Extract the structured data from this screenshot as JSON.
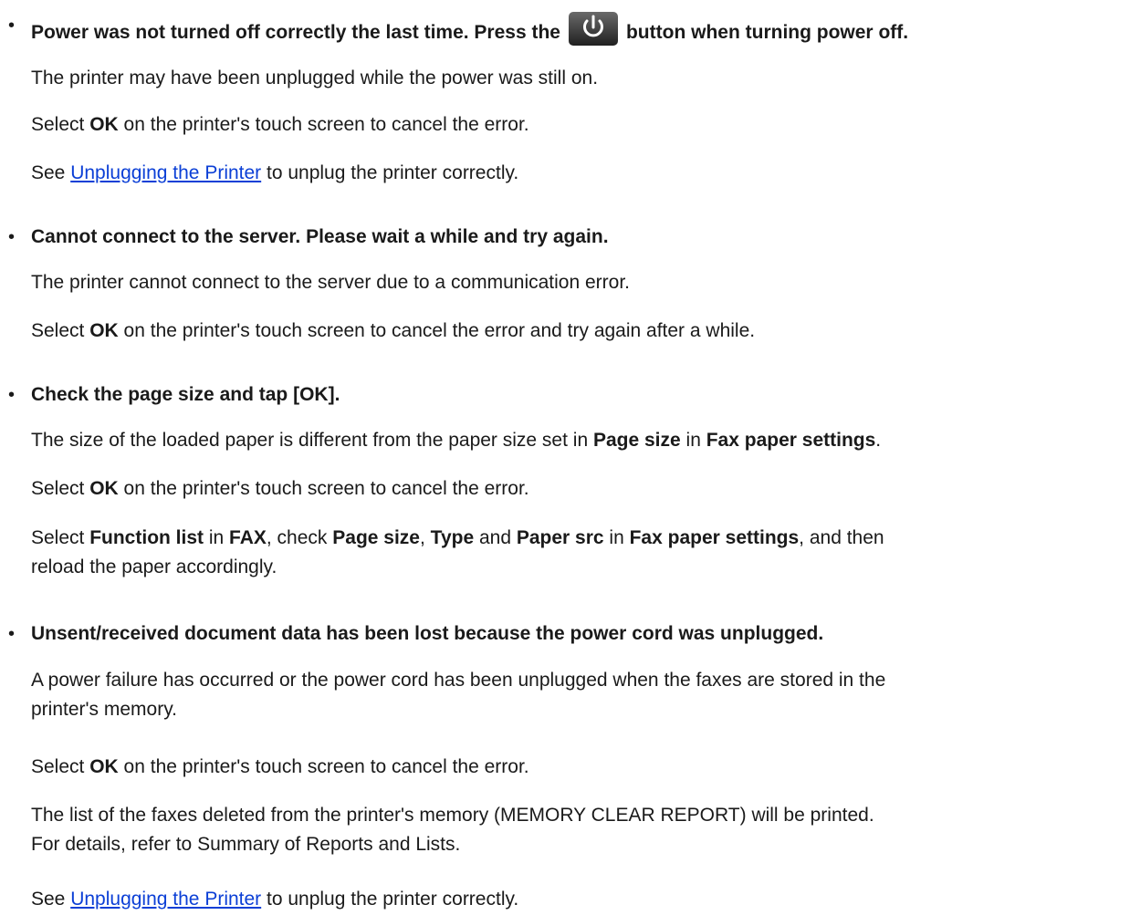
{
  "items": [
    {
      "heading_pre": "Power was not turned off correctly the last time. Press the",
      "heading_post": "button when turning power off.",
      "heading_icon": "power-button-icon",
      "p1": "The printer may have been unplugged while the power was still on.",
      "p2": {
        "pre": "Select ",
        "b1": "OK",
        "post": " on the printer's touch screen to cancel the error."
      },
      "p3": {
        "pre": "See ",
        "link": "Unplugging the Printer",
        "post": " to unplug the printer correctly."
      }
    },
    {
      "heading": "Cannot connect to the server. Please wait a while and try again.",
      "p1": "The printer cannot connect to the server due to a communication error.",
      "p2": {
        "pre": "Select ",
        "b1": "OK",
        "post": " on the printer's touch screen to cancel the error and try again after a while."
      }
    },
    {
      "heading": "Check the page size and tap [OK].",
      "p1": {
        "pre": "The size of the loaded paper is different from the paper size set in ",
        "b1": "Page size",
        "mid": " in ",
        "b2": "Fax paper settings",
        "post": "."
      },
      "p2": {
        "pre": "Select ",
        "b1": "OK",
        "post": " on the printer's touch screen to cancel the error."
      },
      "p3": {
        "t1": "Select ",
        "b1": "Function list",
        "t2": " in ",
        "b2": "FAX",
        "t3": ", check ",
        "b3": "Page size",
        "t4": ", ",
        "b4": "Type",
        "t5": " and ",
        "b5": "Paper src",
        "t6": " in ",
        "b6": "Fax paper settings",
        "t7": ", and then",
        "line2": "reload the paper accordingly."
      }
    },
    {
      "heading": "Unsent/received document data has been lost because the power cord was unplugged.",
      "p1": {
        "line1": "A power failure has occurred or the power cord has been unplugged when the faxes are stored in the",
        "line2": "printer's memory."
      },
      "p2": {
        "pre": "Select ",
        "b1": "OK",
        "post": " on the printer's touch screen to cancel the error."
      },
      "p3": {
        "line1": "The list of the faxes deleted from the printer's memory (MEMORY CLEAR REPORT) will be printed.",
        "line2": "For details, refer to Summary of Reports and Lists."
      },
      "p4": {
        "pre": "See ",
        "link": "Unplugging the Printer",
        "post": " to unplug the printer correctly."
      }
    }
  ]
}
